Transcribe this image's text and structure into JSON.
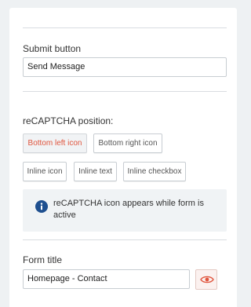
{
  "submit": {
    "label": "Submit button",
    "value": "Send Message"
  },
  "recaptcha": {
    "label": "reCAPTCHA position:",
    "options": [
      {
        "label": "Bottom left icon",
        "selected": true
      },
      {
        "label": "Bottom right icon",
        "selected": false
      },
      {
        "label": "Inline icon",
        "selected": false
      },
      {
        "label": "Inline text",
        "selected": false
      },
      {
        "label": "Inline checkbox",
        "selected": false
      }
    ],
    "info_icon": "info-icon",
    "info_text": "reCAPTCHA icon appears while form is active"
  },
  "form_title": {
    "label": "Form title",
    "value": "Homepage - Contact",
    "toggle_icon": "eye-icon"
  },
  "colors": {
    "selected_option_text": "#e0553e",
    "info_icon": "#1e4f8f",
    "eye_icon": "#e0553e"
  }
}
